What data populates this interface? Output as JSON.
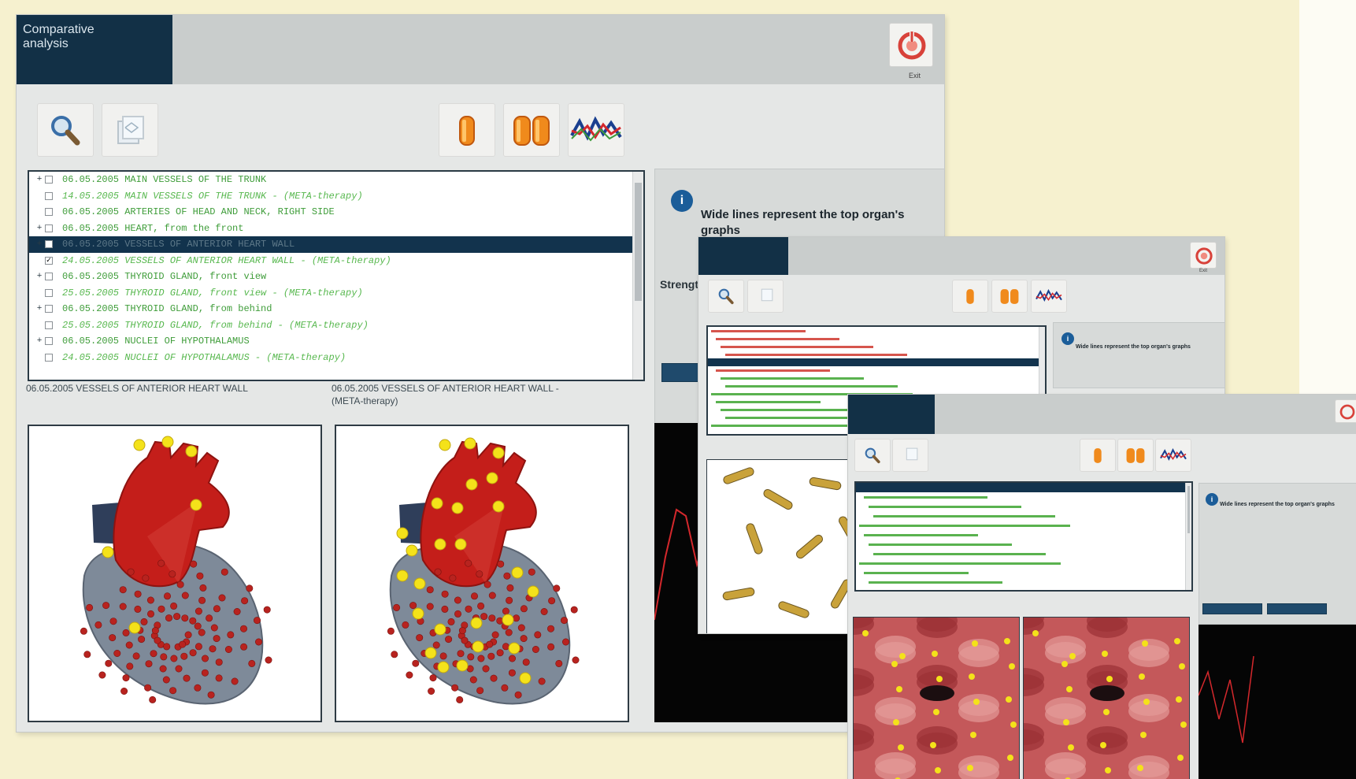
{
  "colors": {
    "background": "#f6f1cf",
    "title_block": "#123046",
    "list_green": "#3f9d3a",
    "list_meta_green": "#58b84f",
    "selection": "#12334d",
    "graph_line": "#d4282c",
    "heart_red": "#c41e1a",
    "marker_yellow": "#f4e21a"
  },
  "window_main": {
    "title_line1": "Comparative",
    "title_line2": "analysis",
    "exit_label": "Exit",
    "toolbar": [
      {
        "icon": "magnifier-search-icon"
      },
      {
        "icon": "copy-document-icon"
      },
      {
        "icon": "single-organ-view-icon"
      },
      {
        "icon": "dual-organ-view-icon"
      },
      {
        "icon": "graph-overlay-icon"
      }
    ],
    "list_items": [
      {
        "mark": "+",
        "checked": false,
        "text": "06.05.2005  MAIN  VESSELS  OF  THE  TRUNK",
        "meta": false
      },
      {
        "mark": "",
        "checked": false,
        "text": "14.05.2005  MAIN  VESSELS  OF  THE  TRUNK  - (META-therapy)",
        "meta": true
      },
      {
        "mark": "",
        "checked": false,
        "text": "06.05.2005  ARTERIES OF HEAD AND NECK, RIGHT SIDE",
        "meta": false
      },
      {
        "mark": "+",
        "checked": false,
        "text": "06.05.2005  HEART,  from the front",
        "meta": false
      },
      {
        "mark": "+",
        "checked": false,
        "text": "06.05.2005  VESSELS OF ANTERIOR HEART  WALL",
        "meta": false,
        "selected": true
      },
      {
        "mark": "",
        "checked": true,
        "text": "24.05.2005  VESSELS OF ANTERIOR HEART  WALL  - (META-therapy)",
        "meta": true
      },
      {
        "mark": "+",
        "checked": false,
        "text": "06.05.2005  THYROID GLAND, front view",
        "meta": false
      },
      {
        "mark": "",
        "checked": false,
        "text": "25.05.2005  THYROID GLAND, front view  - (META-therapy)",
        "meta": true
      },
      {
        "mark": "+",
        "checked": false,
        "text": "06.05.2005  THYROID GLAND,  from behind",
        "meta": false
      },
      {
        "mark": "",
        "checked": false,
        "text": "25.05.2005  THYROID GLAND, from behind  - (META-therapy)",
        "meta": true
      },
      {
        "mark": "+",
        "checked": false,
        "text": "06.05.2005  NUCLEI OF HYPOTHALAMUS",
        "meta": false
      },
      {
        "mark": "",
        "checked": false,
        "text": "24.05.2005  NUCLEI OF HYPOTHALAMUS  - (META-therapy)",
        "meta": true
      }
    ],
    "caption_left": "06.05.2005  VESSELS OF ANTERIOR HEART  WALL",
    "caption_right_line1": "06.05.2005  VESSELS OF ANTERIOR HEART  WALL  -",
    "caption_right_line2": "(META-therapy)",
    "info_text": "Wide lines represent the top organ's graphs",
    "strength_label": "Strength"
  },
  "window_second": {
    "exit_label": "Exit",
    "info_text": "Wide lines represent the top organ's graphs"
  },
  "window_third": {
    "info_text": "Wide lines represent the top organ's graphs"
  }
}
